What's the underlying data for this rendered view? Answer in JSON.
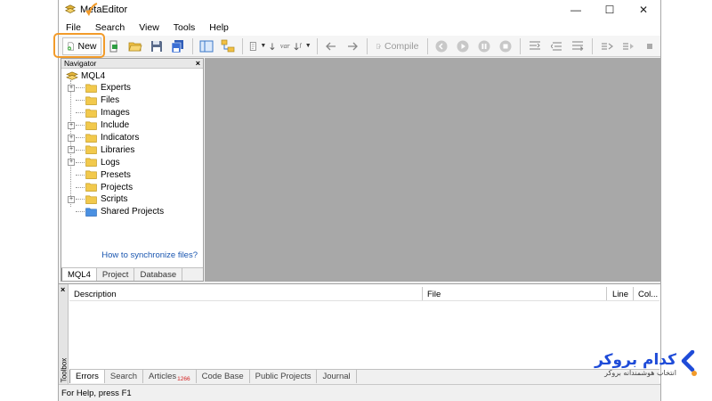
{
  "window": {
    "title": "MetaEditor",
    "controls": [
      "—",
      "☐",
      "✕"
    ]
  },
  "menu": {
    "items": [
      "File",
      "Search",
      "View",
      "Tools",
      "Help"
    ]
  },
  "toolbar": {
    "new_label": "New",
    "compile_label": "Compile",
    "var_label": "var"
  },
  "navigator": {
    "header": "Navigator",
    "root": "MQL4",
    "items": [
      {
        "label": "Experts",
        "expandable": true
      },
      {
        "label": "Files",
        "expandable": false
      },
      {
        "label": "Images",
        "expandable": false
      },
      {
        "label": "Include",
        "expandable": true
      },
      {
        "label": "Indicators",
        "expandable": true
      },
      {
        "label": "Libraries",
        "expandable": true
      },
      {
        "label": "Logs",
        "expandable": true
      },
      {
        "label": "Presets",
        "expandable": false
      },
      {
        "label": "Projects",
        "expandable": false
      },
      {
        "label": "Scripts",
        "expandable": true
      },
      {
        "label": "Shared Projects",
        "expandable": false
      }
    ],
    "sync_link": "How to synchronize files?",
    "tabs": [
      "MQL4",
      "Project",
      "Database"
    ]
  },
  "toolbox": {
    "side_label": "Toolbox",
    "columns": {
      "description": "Description",
      "file": "File",
      "line": "Line",
      "column": "Col..."
    },
    "tabs": [
      "Errors",
      "Search",
      "Articles",
      "Code Base",
      "Public Projects",
      "Journal"
    ],
    "articles_badge": "1266"
  },
  "status": {
    "text": "For Help, press F1"
  },
  "watermark": {
    "main": "کدام بروکر",
    "sub": "انتخاب هوشمندانه بروکر"
  },
  "colors": {
    "highlight": "#f29b2a",
    "editor_bg": "#a8a8a8",
    "link": "#1a56b0",
    "brand": "#1e4bd8"
  }
}
